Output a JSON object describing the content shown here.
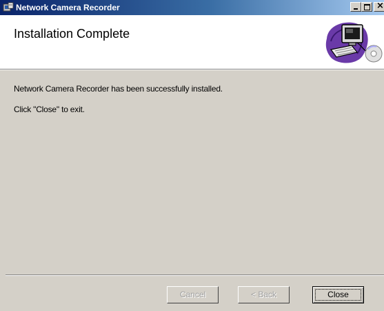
{
  "window": {
    "title": "Network Camera Recorder",
    "minimize_glyph": "",
    "maximize_glyph": "",
    "close_glyph": "×"
  },
  "banner": {
    "title": "Installation Complete",
    "art_icon": "computer-setup-icon"
  },
  "body": {
    "message": "Network Camera Recorder has been successfully installed.",
    "instruction": "Click \"Close\" to exit."
  },
  "buttons": {
    "cancel": "Cancel",
    "back": "Back",
    "close": "Close"
  },
  "colors": {
    "titlebar_start": "#0a246a",
    "titlebar_end": "#a6caf0",
    "dialog_bg": "#d4d0c8",
    "banner_bg": "#ffffff",
    "art_accent": "#6a3aa8"
  }
}
